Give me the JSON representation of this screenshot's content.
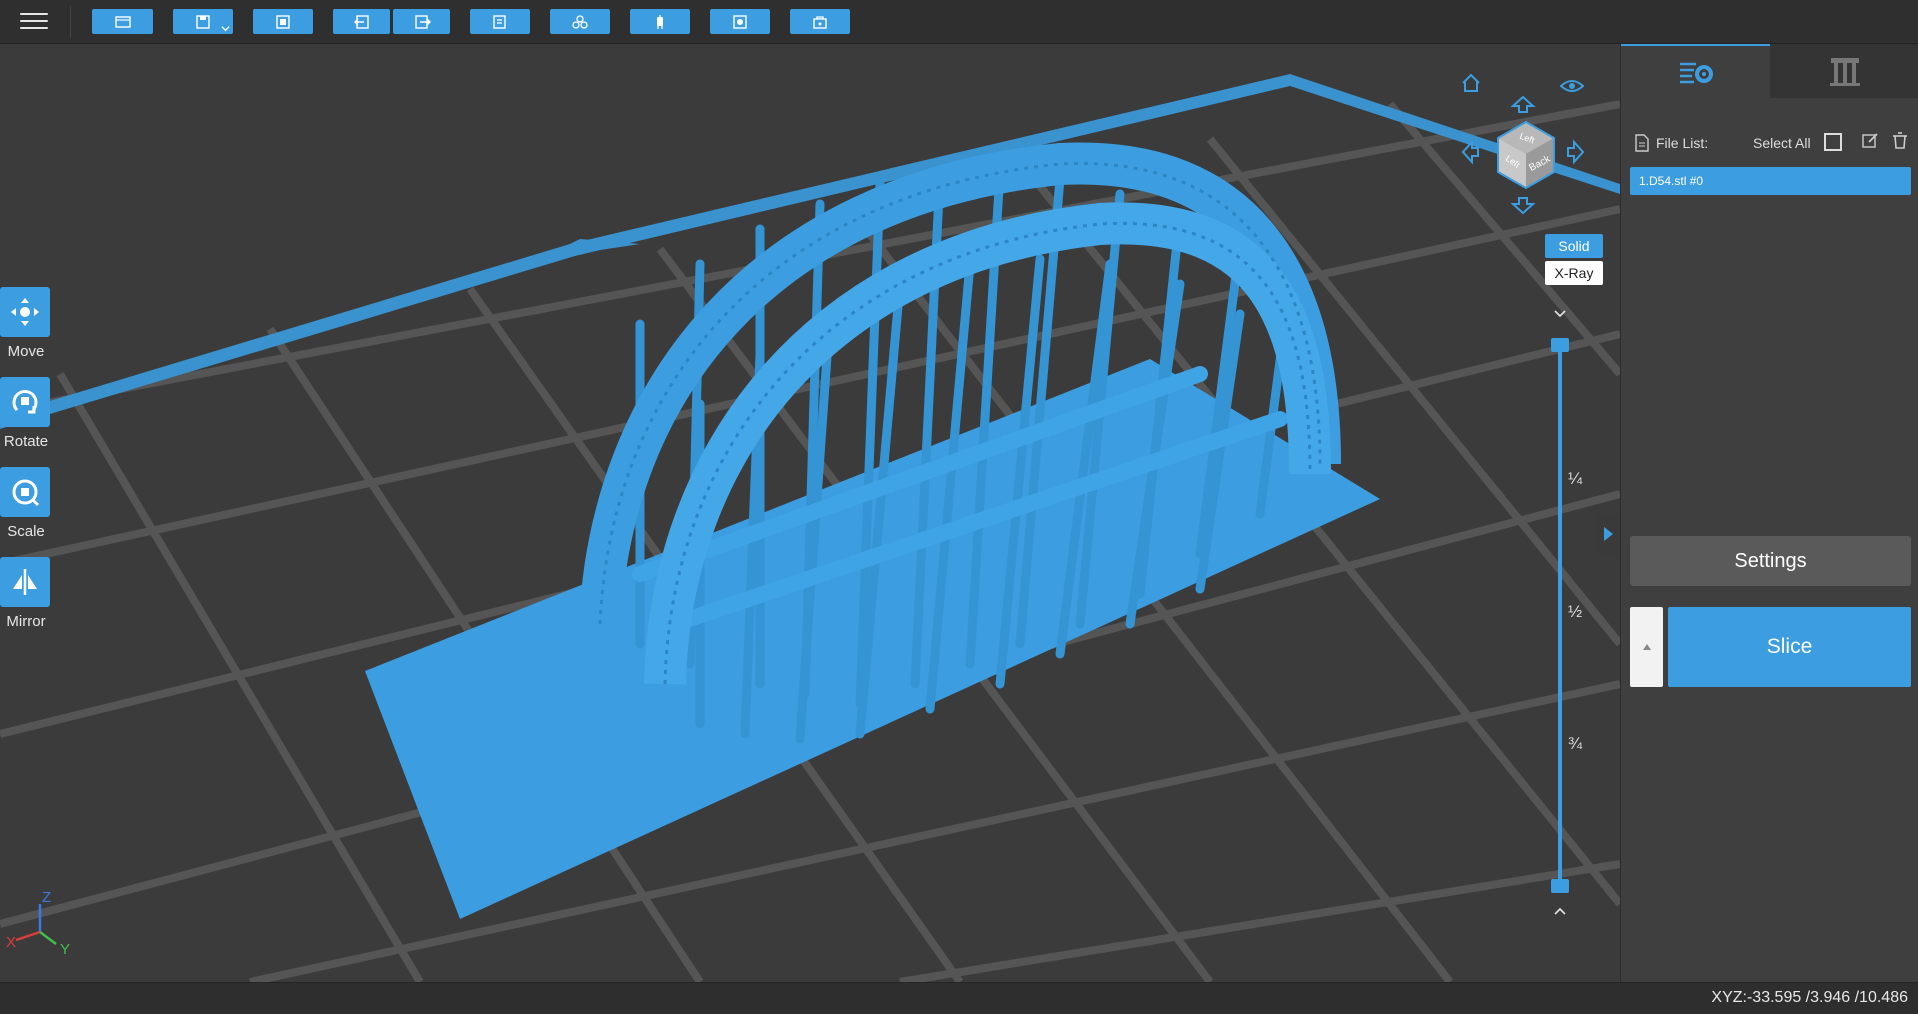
{
  "toolbar": {
    "buttons": [
      {
        "name": "open-file-button",
        "icon": "folder-icon"
      },
      {
        "name": "save-button",
        "icon": "floppy-icon"
      },
      {
        "name": "screenshot-button",
        "icon": "frame-icon"
      },
      {
        "name": "import-button",
        "icon": "import-icon"
      },
      {
        "name": "export-button",
        "icon": "export-icon"
      },
      {
        "name": "copy-button",
        "icon": "copy-icon"
      },
      {
        "name": "arrange-button",
        "icon": "arrange-icon"
      },
      {
        "name": "support-button",
        "icon": "support-icon"
      },
      {
        "name": "hollow-button",
        "icon": "hollow-icon"
      },
      {
        "name": "drill-button",
        "icon": "drill-icon"
      }
    ]
  },
  "tools": [
    {
      "label": "Move",
      "icon": "move-icon"
    },
    {
      "label": "Rotate",
      "icon": "rotate-icon"
    },
    {
      "label": "Scale",
      "icon": "scale-icon"
    },
    {
      "label": "Mirror",
      "icon": "mirror-icon"
    }
  ],
  "viewport": {
    "view_modes": [
      "Solid",
      "X-Ray"
    ],
    "active_mode": "Solid",
    "cube_faces": [
      "Left",
      "Back",
      "Left"
    ],
    "slider_marks": [
      "¼",
      "½",
      "¾"
    ],
    "axes": {
      "x": "X",
      "y": "Y",
      "z": "Z"
    },
    "accent": "#3c9ee0"
  },
  "panel": {
    "file_list_label": "File List:",
    "select_all_label": "Select All",
    "files": [
      "1.D54.stl #0"
    ],
    "settings_label": "Settings",
    "slice_label": "Slice"
  },
  "status": {
    "coords": "XYZ:-33.595 /3.946 /10.486"
  }
}
